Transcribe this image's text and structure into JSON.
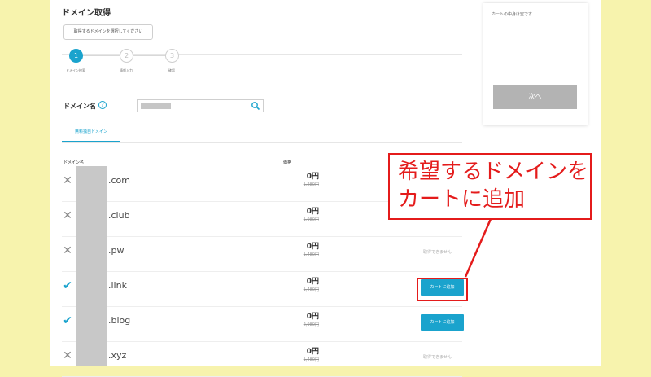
{
  "page": {
    "title": "ドメイン取得",
    "hint_button": "取得するドメインを選択してください"
  },
  "steps": [
    {
      "num": "1",
      "label": "ドメイン検索"
    },
    {
      "num": "2",
      "label": "情報入力"
    },
    {
      "num": "3",
      "label": "確認"
    }
  ],
  "search": {
    "label": "ドメイン名",
    "help": "?"
  },
  "tab": {
    "label": "無料独自ドメイン"
  },
  "table": {
    "col_domain": "ドメイン名",
    "col_price": "価格",
    "rows": [
      {
        "tld": ".com",
        "price": "0円",
        "original": "1,280円",
        "available": false,
        "status": ""
      },
      {
        "tld": ".club",
        "price": "0円",
        "original": "1,980円",
        "available": false,
        "status": ""
      },
      {
        "tld": ".pw",
        "price": "0円",
        "original": "1,480円",
        "available": false,
        "status": "取得できません"
      },
      {
        "tld": ".link",
        "price": "0円",
        "original": "1,480円",
        "available": true,
        "button": "カートに追加"
      },
      {
        "tld": ".blog",
        "price": "0円",
        "original": "2,980円",
        "available": true,
        "button": "カートに追加"
      },
      {
        "tld": ".xyz",
        "price": "0円",
        "original": "1,480円",
        "available": false,
        "status": "取得できません"
      }
    ]
  },
  "cart": {
    "empty_text": "カートの中身は空です",
    "next_button": "次へ"
  },
  "callout": {
    "line1": "希望するドメインを",
    "line2": "カートに追加"
  },
  "colors": {
    "accent": "#1aa3cd",
    "annotation": "#e41b1b",
    "background": "#f7f3ad"
  },
  "icons": {
    "search": "search-icon",
    "unavailable": "x-mark-icon",
    "available": "checkmark-icon"
  }
}
